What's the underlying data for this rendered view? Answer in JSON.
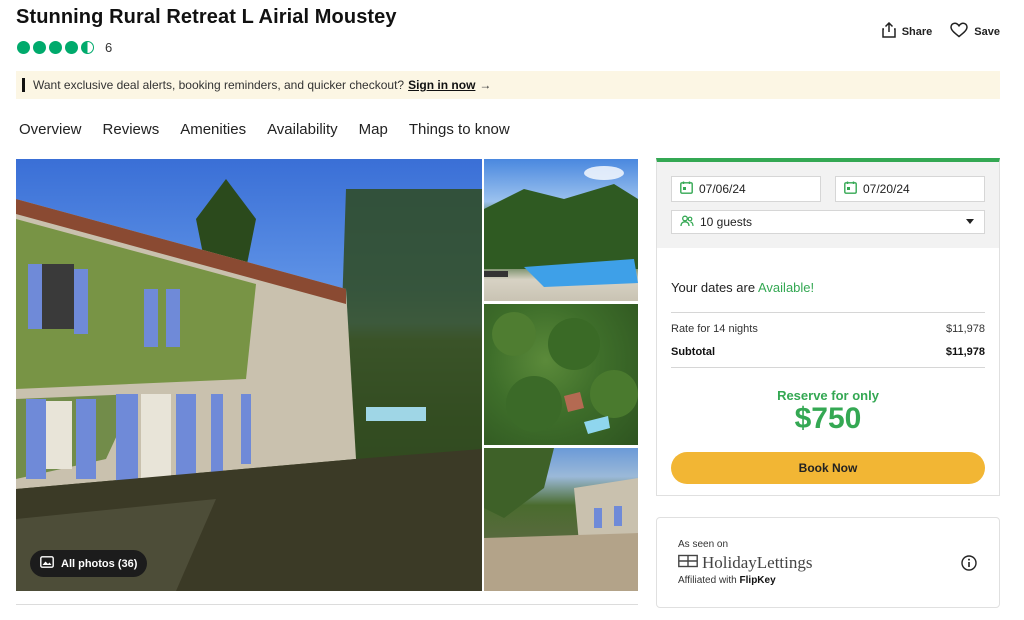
{
  "listing": {
    "title": "Stunning Rural Retreat L Airial Moustey",
    "rating": 4.5,
    "review_count": "6"
  },
  "header_actions": {
    "share_label": "Share",
    "save_label": "Save"
  },
  "promo": {
    "text": "Want exclusive deal alerts, booking reminders, and quicker checkout?",
    "link": "Sign in now",
    "arrow": "→"
  },
  "tabs": [
    "Overview",
    "Reviews",
    "Amenities",
    "Availability",
    "Map",
    "Things to know"
  ],
  "gallery": {
    "all_photos_label": "All photos (36)"
  },
  "booking": {
    "check_in": "07/06/24",
    "check_out": "07/20/24",
    "guests": "10 guests",
    "availability_prefix": "Your dates are",
    "availability_status": "Available!",
    "rate_label": "Rate for 14 nights",
    "rate_value": "$11,978",
    "subtotal_label": "Subtotal",
    "subtotal_value": "$11,978",
    "reserve_label": "Reserve for only",
    "reserve_price": "$750",
    "book_button": "Book Now"
  },
  "partner": {
    "seen_on": "As seen on",
    "logo_text": "HolidayLettings",
    "affiliated_prefix": "Affiliated with",
    "affiliated_brand": "FlipKey"
  },
  "colors": {
    "brand_green": "#34a853",
    "rating_green": "#00aa6c",
    "book_button": "#f2b634",
    "promo_bg": "#fcf6e4"
  },
  "icons": [
    "share-icon",
    "heart-icon",
    "calendar-icon",
    "guests-icon",
    "chevron-down-icon",
    "photos-icon",
    "info-icon",
    "holidaylettings-logo-icon"
  ]
}
